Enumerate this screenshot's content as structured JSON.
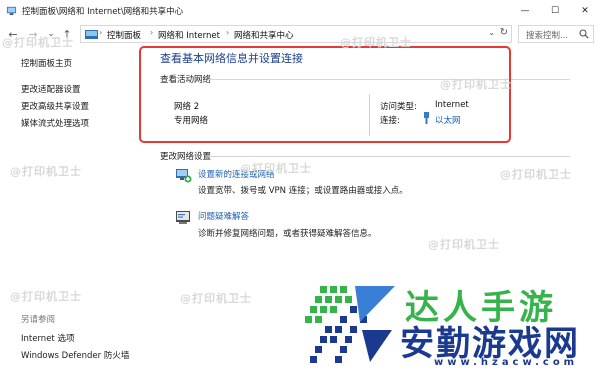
{
  "window": {
    "title": "控制面板\\网络和 Internet\\网络和共享中心",
    "minimize_glyph": "—",
    "maximize_glyph": "☐",
    "close_glyph": "✕"
  },
  "nav": {
    "back_glyph": "←",
    "forward_glyph": "→",
    "recent_glyph": "⌄",
    "up_glyph": "↑"
  },
  "address": {
    "crumbs": [
      "控制面板",
      "网络和 Internet",
      "网络和共享中心"
    ],
    "separator": "›",
    "dropdown_glyph": "⌄",
    "refresh_glyph": "↻"
  },
  "search": {
    "placeholder": "搜索控制..."
  },
  "sidebar": {
    "items": [
      {
        "label": "控制面板主页"
      },
      {
        "label": "更改适配器设置"
      },
      {
        "label": "更改高级共享设置"
      },
      {
        "label": "媒体流式处理选项"
      }
    ],
    "see_also_heading": "另请参阅",
    "see_also": [
      {
        "label": "Internet 选项"
      },
      {
        "label": "Windows Defender 防火墙"
      }
    ]
  },
  "main": {
    "title": "查看基本网络信息并设置连接",
    "active_networks_label": "查看活动网络",
    "network": {
      "name": "网络 2",
      "type": "专用网络",
      "access_label": "访问类型:",
      "access_value": "Internet",
      "connections_label": "连接:",
      "connections_value": "以太网"
    },
    "change_settings_label": "更改网络设置",
    "tasks": [
      {
        "link": "设置新的连接或网络",
        "desc": "设置宽带、拨号或 VPN 连接；或设置路由器或接入点。",
        "icon": "network-setup-icon"
      },
      {
        "link": "问题疑难解答",
        "desc": "诊断并修复网络问题，或者获得疑难解答信息。",
        "icon": "troubleshoot-icon"
      }
    ]
  },
  "watermarks": [
    "@打印机卫士",
    "@打印机卫士",
    "@打印机卫士",
    "@打印机卫士",
    "@打印机卫士",
    "@打印机卫士",
    "@打印机卫士",
    "@打印机卫士",
    "@打印机卫士"
  ],
  "brand": {
    "line1": "达人手游",
    "line2": "安勤游戏网",
    "url": "www.hzacw.com"
  },
  "colors": {
    "link_blue": "#1a5fb4",
    "title_blue": "#1a3e8a",
    "highlight_red": "#e53935",
    "brand_green": "#36b34a",
    "brand_navy": "#1b3a8f"
  }
}
